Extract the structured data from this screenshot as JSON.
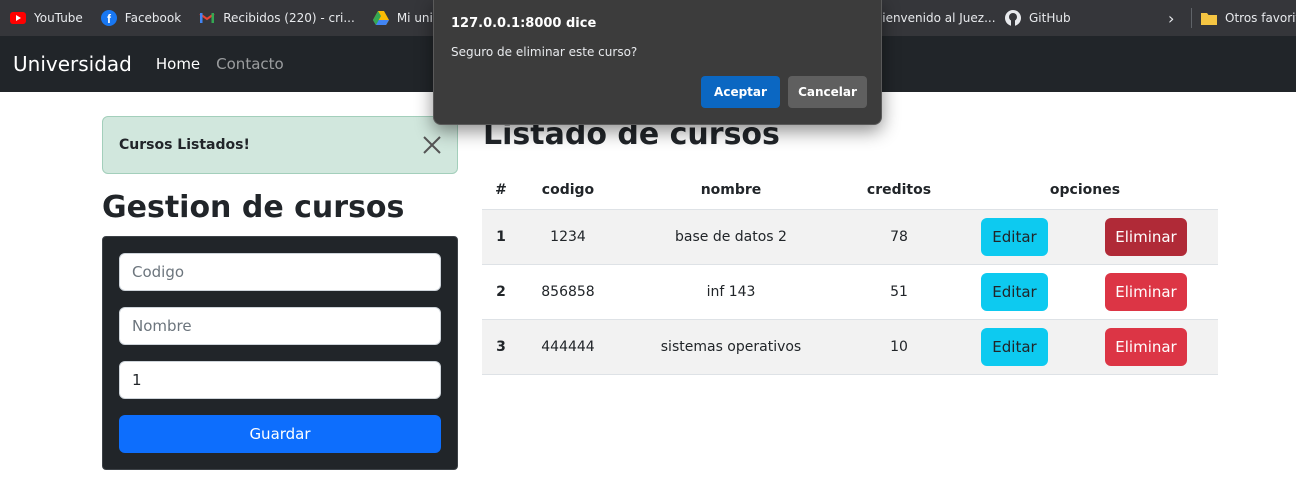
{
  "bookmarks": {
    "items": [
      {
        "label": "YouTube",
        "icon": "youtube-icon"
      },
      {
        "label": "Facebook",
        "icon": "facebook-icon"
      },
      {
        "label": "Recibidos (220) - cri...",
        "icon": "gmail-icon"
      },
      {
        "label": "Mi unidad - (",
        "icon": "drive-icon"
      }
    ],
    "right_items": [
      {
        "label": "Bienvenido al Juez...",
        "icon": "juez-icon"
      },
      {
        "label": "GitHub",
        "icon": "github-icon"
      }
    ],
    "folder_label": "Otros favoritos",
    "colors": {
      "youtube": "#ff0000",
      "facebook": "#1877f2"
    }
  },
  "navbar": {
    "brand": "Universidad",
    "links": [
      "Home",
      "Contacto"
    ]
  },
  "alert": {
    "text": "Cursos Listados!"
  },
  "form": {
    "heading": "Gestion de cursos",
    "codigo_placeholder": "Codigo",
    "nombre_placeholder": "Nombre",
    "creditos_value": "1",
    "submit_label": "Guardar"
  },
  "listing": {
    "heading": "Listado de cursos",
    "columns": [
      "#",
      "codigo",
      "nombre",
      "creditos",
      "opciones"
    ],
    "rows": [
      {
        "num": "1",
        "codigo": "1234",
        "nombre": "base de datos 2",
        "creditos": "78"
      },
      {
        "num": "2",
        "codigo": "856858",
        "nombre": "inf 143",
        "creditos": "51"
      },
      {
        "num": "3",
        "codigo": "444444",
        "nombre": "sistemas operativos",
        "creditos": "10"
      }
    ],
    "edit_label": "Editar",
    "delete_label": "Eliminar"
  },
  "dialog": {
    "title": "127.0.0.1:8000 dice",
    "message": "Seguro de eliminar este curso?",
    "ok_label": "Aceptar",
    "cancel_label": "Cancelar"
  },
  "colors": {
    "primary": "#0d6efd",
    "info": "#0dcaf0",
    "danger": "#dc3545",
    "success_bg": "#d1e7dd",
    "navbar_bg": "#212529"
  }
}
